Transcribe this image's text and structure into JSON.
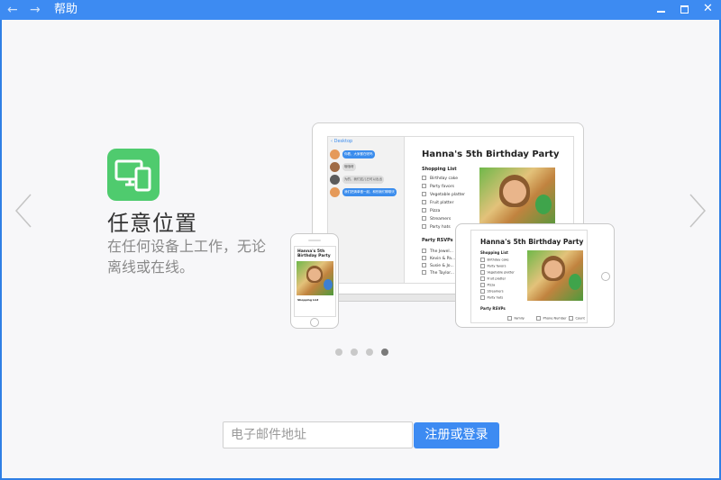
{
  "window": {
    "title": "帮助",
    "back_icon": "←",
    "forward_icon": "→",
    "close_glyph": "✕"
  },
  "colors": {
    "titlebar": "#3d8bf2",
    "accent": "#3d8bf2",
    "feature_icon": "#4fcb6e"
  },
  "feature": {
    "icon": "devices-icon",
    "title": "任意位置",
    "description": "在任何设备上工作，无论离线或在线。"
  },
  "illustration": {
    "laptop": {
      "back_label": "Desktop",
      "chat": [
        "你看，大家都在呢吗",
        "哦哦呀",
        "为的，我们这儿已可以出出",
        "我们把清单做一起，和别我们聊聊天"
      ],
      "doc_title": "Hanna's 5th Birthday Party",
      "list_title": "Shopping List",
      "items": [
        "Birthday cake",
        "Party favors",
        "Vegetable platter",
        "Fruit platter",
        "Pizza",
        "Streamers",
        "Party hats"
      ],
      "rsvp_title": "Party RSVPs",
      "rsvp_rows": [
        "The Jewel...",
        "Kevin & Pa...",
        "Susie & Jo...",
        "The Taylor..."
      ]
    },
    "tablet": {
      "doc_title": "Hanna's 5th Birthday Party",
      "list_title": "Shopping List",
      "items": [
        "Birthday cake",
        "Party favors",
        "Vegetable platter",
        "Fruit platter",
        "Pizza",
        "Streamers",
        "Party hats"
      ],
      "rsvp_title": "Party RSVPs",
      "rsvp_cols": [
        "Family",
        "Phone Number",
        "Count"
      ]
    },
    "phone": {
      "doc_title": "Hanna's 5th Birthday Party",
      "list_title": "Shopping List"
    }
  },
  "carousel": {
    "total": 4,
    "active_index": 3
  },
  "signup": {
    "email_placeholder": "电子邮件地址",
    "email_value": "",
    "button_label": "注册或登录"
  }
}
